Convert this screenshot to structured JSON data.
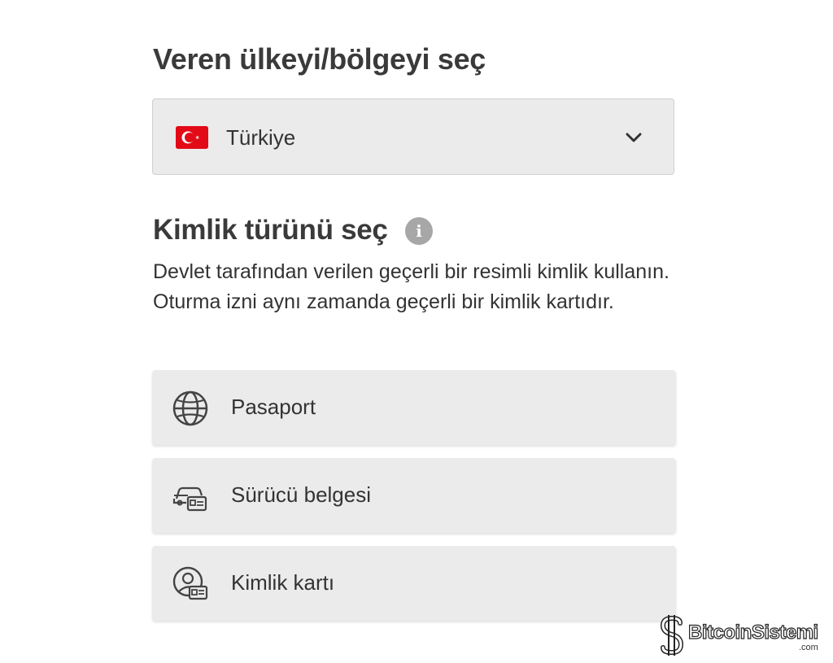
{
  "country_section": {
    "title": "Veren ülkeyi/bölgeyi seç",
    "selected_country": "Türkiye"
  },
  "id_section": {
    "title": "Kimlik türünü seç",
    "description": "Devlet tarafından verilen geçerli bir resimli kimlik kullanın. Oturma izni aynı zamanda geçerli bir kimlik kartıdır."
  },
  "id_options": [
    {
      "label": "Pasaport",
      "icon": "globe-icon"
    },
    {
      "label": "Sürücü belgesi",
      "icon": "car-card-icon"
    },
    {
      "label": "Kimlik kartı",
      "icon": "person-card-icon"
    }
  ],
  "watermark": {
    "text": "BitcoinSistemi",
    "suffix": ".com"
  },
  "colors": {
    "background": "#ffffff",
    "field": "#ebebeb",
    "flag": "#e30a17",
    "info": "#a7a7a7"
  }
}
